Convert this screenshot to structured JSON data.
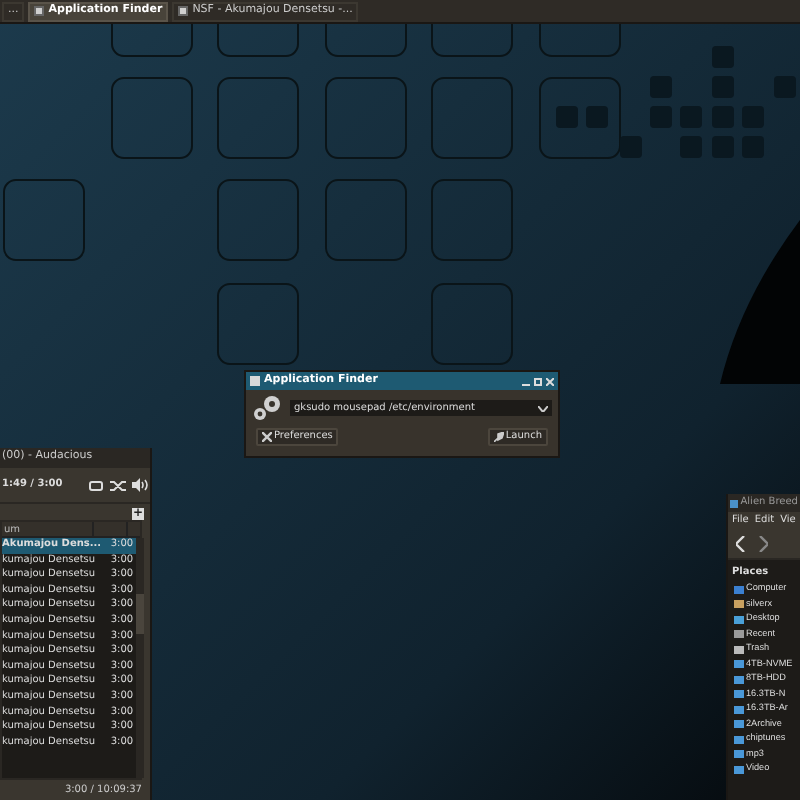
{
  "taskbar": {
    "tasks": [
      {
        "label": "...",
        "selected": false
      },
      {
        "label": "Application Finder",
        "selected": true
      },
      {
        "label": "NSF - Akumajou Densetsu -...",
        "selected": false
      }
    ]
  },
  "app_finder": {
    "title": "Application Finder",
    "command": "gksudo mousepad /etc/environment",
    "buttons": [
      {
        "label": "Preferences",
        "kind": "preferences"
      },
      {
        "label": "Launch",
        "kind": "launch"
      }
    ]
  },
  "audacious": {
    "title": "(00) - Audacious",
    "time": "1:49 / 3:00",
    "add_tab": "+",
    "column_header": "um",
    "rows": [
      {
        "album": "Akumajou Dens...",
        "length": "3:00",
        "selected": true
      },
      {
        "album": "kumajou Densetsu",
        "length": "3:00",
        "selected": false
      },
      {
        "album": "kumajou Densetsu",
        "length": "3:00",
        "selected": false
      },
      {
        "album": "kumajou Densetsu",
        "length": "3:00",
        "selected": false
      },
      {
        "album": "kumajou Densetsu",
        "length": "3:00",
        "selected": false
      },
      {
        "album": "kumajou Densetsu",
        "length": "3:00",
        "selected": false
      },
      {
        "album": "kumajou Densetsu",
        "length": "3:00",
        "selected": false
      },
      {
        "album": "kumajou Densetsu",
        "length": "3:00",
        "selected": false
      },
      {
        "album": "kumajou Densetsu",
        "length": "3:00",
        "selected": false
      },
      {
        "album": "kumajou Densetsu",
        "length": "3:00",
        "selected": false
      },
      {
        "album": "kumajou Densetsu",
        "length": "3:00",
        "selected": false
      },
      {
        "album": "kumajou Densetsu",
        "length": "3:00",
        "selected": false
      },
      {
        "album": "kumajou Densetsu",
        "length": "3:00",
        "selected": false
      },
      {
        "album": "kumajou Densetsu",
        "length": "3:00",
        "selected": false
      }
    ],
    "status": "3:00 / 10:09:37"
  },
  "file_manager": {
    "title": "Alien Breed",
    "menu": [
      "File",
      "Edit",
      "Vie"
    ],
    "places_heading": "Places",
    "places": [
      {
        "label": "Computer",
        "kind": "computer"
      },
      {
        "label": "silverx",
        "kind": "home"
      },
      {
        "label": "Desktop",
        "kind": "desktop"
      },
      {
        "label": "Recent",
        "kind": "recent"
      },
      {
        "label": "Trash",
        "kind": "trash"
      },
      {
        "label": "4TB-NVME",
        "kind": "folder"
      },
      {
        "label": "8TB-HDD",
        "kind": "folder"
      },
      {
        "label": "16.3TB-N",
        "kind": "folder"
      },
      {
        "label": "16.3TB-Ar",
        "kind": "folder"
      },
      {
        "label": "2Archive",
        "kind": "folder"
      },
      {
        "label": "chiptunes",
        "kind": "folder"
      },
      {
        "label": "mp3",
        "kind": "folder"
      },
      {
        "label": "Video",
        "kind": "folder"
      }
    ]
  }
}
